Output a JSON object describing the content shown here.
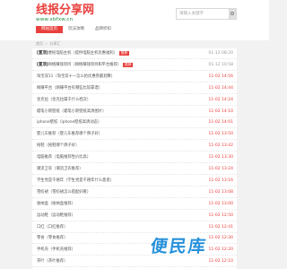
{
  "header": {
    "logo_main": "线报分享网",
    "logo_sub": "www.xbfxw.cn",
    "search_placeholder": "请输入关键字"
  },
  "nav": {
    "items": [
      {
        "label": "网站首页",
        "active": true
      },
      {
        "label": "玩法攻略",
        "active": false
      },
      {
        "label": "品牌折扣",
        "active": false
      }
    ]
  },
  "breadcrumb": {
    "items": [
      "首页",
      "分享汇"
    ],
    "separator": ">"
  },
  "list": {
    "rows": [
      {
        "prefix": "[置顶]",
        "title": "便民电脑主机（提供电脑主机优惠福利）",
        "badge": "推荐",
        "date": "01-12 08:20"
      },
      {
        "prefix": "[置顶]",
        "title": "网络赚钱项目（网络赚钱项目和平台推荐）",
        "badge": "推荐",
        "date": "01-12 10:58"
      },
      {
        "prefix": "",
        "title": "淘宝双11（淘宝双十一怎么抢优惠券最划算）",
        "badge": "",
        "date": "11-02 14:56"
      },
      {
        "prefix": "",
        "title": "网赚平台（网赚平台有哪些比较靠谱）",
        "badge": "",
        "date": "11-02 14:44"
      },
      {
        "prefix": "",
        "title": "金克拉（金克拉属于什么档次）",
        "badge": "",
        "date": "11-02 14:24"
      },
      {
        "prefix": "",
        "title": "蜡笔小新壁纸（蜡笔小新壁纸高清图片）",
        "badge": "",
        "date": "11-02 14:10"
      },
      {
        "prefix": "",
        "title": "iphone壁纸（iphone壁纸高清动态）",
        "badge": "",
        "date": "11-02 14:01"
      },
      {
        "prefix": "",
        "title": "婴儿车推荐（婴儿车推荐哪个牌子好）",
        "badge": "",
        "date": "11-02 13:50"
      },
      {
        "prefix": "",
        "title": "拖鞋（拖鞋哪个牌子好）",
        "badge": "",
        "date": "11-02 13:42"
      },
      {
        "prefix": "",
        "title": "电脑推荐（电脑推荐性价比高）",
        "badge": "",
        "date": "11-02 13:30"
      },
      {
        "prefix": "",
        "title": "潮流卫衣（潮流卫衣推荐）",
        "badge": "",
        "date": "11-02 13:24"
      },
      {
        "prefix": "",
        "title": "学生党是千禧年（学生党是千禧年什么意思）",
        "badge": "",
        "date": "11-02 13:16"
      },
      {
        "prefix": "",
        "title": "雪纺裙（雪纺裙怎么搭配好看）",
        "badge": "",
        "date": "11-02 13:08"
      },
      {
        "prefix": "",
        "title": "收纳盒（收纳盒推荐）",
        "badge": "",
        "date": "11-02 13:00"
      },
      {
        "prefix": "",
        "title": "运动鞋（运动鞋推荐）",
        "badge": "",
        "date": "11-02 12:50"
      },
      {
        "prefix": "",
        "title": "口红（口红推荐）",
        "badge": "",
        "date": "11-02 12:41"
      },
      {
        "prefix": "",
        "title": "零食（零食推荐）",
        "badge": "",
        "date": "11-02 12:30"
      },
      {
        "prefix": "",
        "title": "手机壳（手机壳推荐）",
        "badge": "",
        "date": "11-02 12:20"
      },
      {
        "prefix": "",
        "title": "茶叶（茶叶推荐）",
        "badge": "",
        "date": "11-02 12:10"
      }
    ]
  },
  "watermark": "便民库",
  "colors": {
    "accent": "#e8413d",
    "logo_sub": "#1a8a3e",
    "watermark": "#1b8bd9",
    "page_bg": "#f2f2f2"
  }
}
